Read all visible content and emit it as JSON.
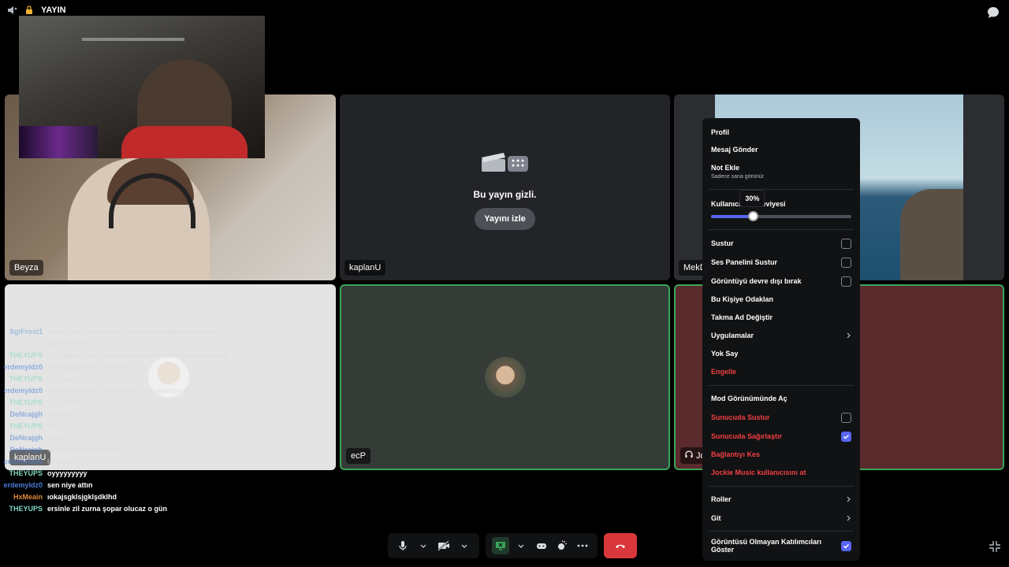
{
  "topbar": {
    "stream_label": "YAYIN"
  },
  "tiles": {
    "beyza": {
      "label": "Beyza"
    },
    "kaplanu": {
      "label": "kaplanU",
      "hidden_text": "Bu yayın gizli.",
      "watch_button": "Yayını izle"
    },
    "mek": {
      "label": "MekD"
    },
    "screen": {
      "label": "kaplanU"
    },
    "ecp": {
      "label": "ecP"
    },
    "jo": {
      "label": "Jo"
    }
  },
  "chat": [
    {
      "user": "SgtFrost1",
      "text": "kuzen ben kaçıyorum oğuyorum o sağdaki fotonun",
      "color": "#6aa0d8",
      "faded": true
    },
    {
      "user": "",
      "text": "gözlerinden",
      "color": "#6aa0d8",
      "faded": true
    },
    {
      "user": "THEYUPS",
      "text": "@HxMeain sadikdaskisadasdkdaskdkaskdsksdiksdik",
      "color": "#7fd6c2",
      "faded": true
    },
    {
      "user": "erdemyldz0",
      "text": "kedi duygulanıp oynadı",
      "color": "#4a7bd8",
      "faded": true
    },
    {
      "user": "THEYUPS",
      "text": "hazırım",
      "color": "#7fd6c2",
      "faded": true
    },
    {
      "user": "erdemyldz0",
      "text": "bazen çok kıncı oluyorsun @mrakhoidyumi",
      "color": "#4a7bd8",
      "faded": true
    },
    {
      "user": "THEYUPS",
      "text": "sesi kapalı",
      "color": "#7fd6c2",
      "faded": true
    },
    {
      "user": "DeNcajgh",
      "text": "lanatma",
      "color": "#4a7bd8",
      "faded": true
    },
    {
      "user": "THEYUPS",
      "text": "aq",
      "color": "#7fd6c2",
      "faded": true
    },
    {
      "user": "DeNcajgh",
      "text": "atma",
      "color": "#4a7bd8",
      "faded": true
    },
    {
      "user": "DeNcajgh",
      "text": "sohbetin içine sıçma",
      "color": "#4a7bd8",
      "faded": true
    },
    {
      "user": "erdemyldz0",
      "text": "lan olm",
      "color": "#4a7bd8",
      "faded": true
    },
    {
      "user": "THEYUPS",
      "text": "oyyyyyyyyy",
      "color": "#7fd6c2",
      "faded": false
    },
    {
      "user": "erdemyldz0",
      "text": "sen niye attın",
      "color": "#4a7bd8",
      "faded": false
    },
    {
      "user": "HxMeain",
      "text": "ıokajsgklsjgklşdklhd",
      "color": "#e08a3c",
      "faded": false
    },
    {
      "user": "THEYUPS",
      "text": "ersinle zil zurna şopar olucaz o gün",
      "color": "#7fd6c2",
      "faded": false
    }
  ],
  "menu": {
    "profile": "Profil",
    "send_message": "Mesaj Gönder",
    "add_note": "Not Ekle",
    "add_note_sub": "Sadece sana görünür",
    "volume_label": "Kullanıcı Ses Seviyesi",
    "volume_tooltip": "30%",
    "volume_value": 0.3,
    "mute": "Sustur",
    "mute_soundboard": "Ses Panelini Sustur",
    "disable_video": "Görüntüyü devre dışı bırak",
    "focus_person": "Bu Kişiye Odaklan",
    "change_nickname": "Takma Ad Değiştir",
    "apps": "Uygulamalar",
    "ignore": "Yok Say",
    "block": "Engelle",
    "open_mod_view": "Mod Görünümünde Aç",
    "server_mute": "Sunucuda Sustur",
    "server_deafen": "Sunucuda Sağırlaştır",
    "disconnect": "Bağlantıyı Kes",
    "kick_user": "Jockie Music kullanıcısını at",
    "roles": "Roller",
    "go": "Git",
    "show_non_video": "Görüntüsü Olmayan Katılımcıları Göster",
    "checks": {
      "mute": false,
      "mute_soundboard": false,
      "disable_video": false,
      "server_mute": false,
      "server_deafen": true,
      "show_non_video": true
    }
  },
  "colors": {
    "accent": "#5865f2",
    "danger": "#f23f42",
    "speaking": "#3ba55c",
    "hangup": "#da373c"
  },
  "icons": [
    "speaker-icon",
    "lock-icon",
    "chat-bubble-icon",
    "mic-icon",
    "camera-off-icon",
    "screen-share-icon",
    "activity-icon",
    "soundboard-icon",
    "more-icon",
    "hangup-icon",
    "shrink-icon",
    "headphones-icon",
    "chevron-right-icon",
    "check-icon"
  ]
}
